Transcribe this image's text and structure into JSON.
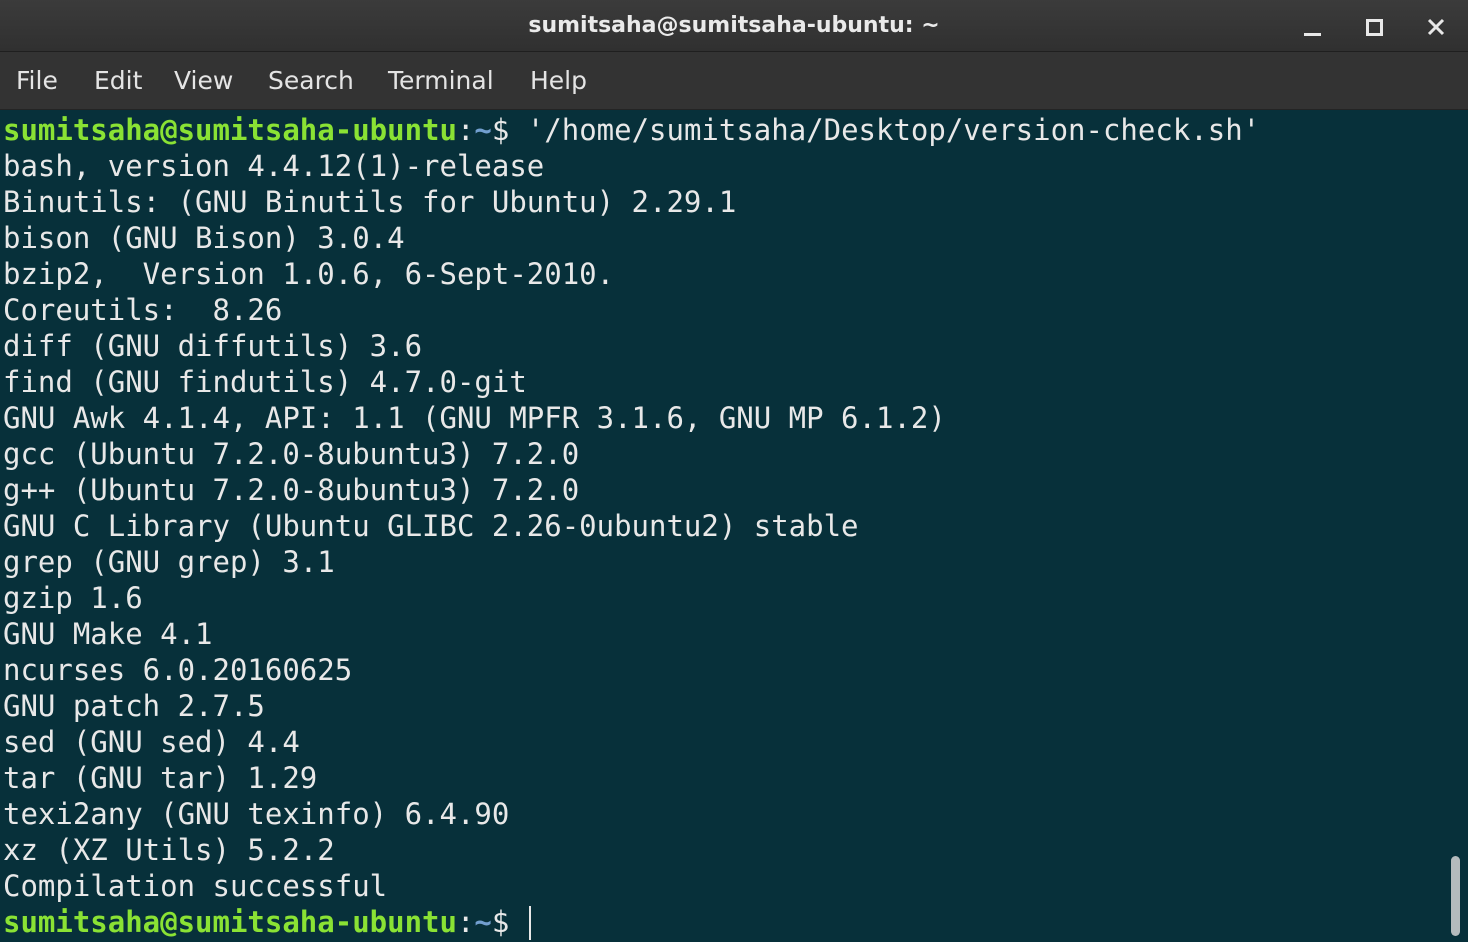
{
  "window": {
    "title": "sumitsaha@sumitsaha-ubuntu: ~",
    "controls": [
      "minimize-icon",
      "maximize-icon",
      "close-icon"
    ]
  },
  "menu": [
    "File",
    "Edit",
    "View",
    "Search",
    "Terminal",
    "Help"
  ],
  "terminal": {
    "prompt": {
      "user": "sumitsaha@sumitsaha-ubuntu",
      "sep": ":",
      "path": "~",
      "sym": "$ "
    },
    "command": "'/home/sumitsaha/Desktop/version-check.sh'",
    "output": [
      "bash, version 4.4.12(1)-release",
      "Binutils: (GNU Binutils for Ubuntu) 2.29.1",
      "bison (GNU Bison) 3.0.4",
      "bzip2,  Version 1.0.6, 6-Sept-2010.",
      "Coreutils:  8.26",
      "diff (GNU diffutils) 3.6",
      "find (GNU findutils) 4.7.0-git",
      "GNU Awk 4.1.4, API: 1.1 (GNU MPFR 3.1.6, GNU MP 6.1.2)",
      "gcc (Ubuntu 7.2.0-8ubuntu3) 7.2.0",
      "g++ (Ubuntu 7.2.0-8ubuntu3) 7.2.0",
      "GNU C Library (Ubuntu GLIBC 2.26-0ubuntu2) stable",
      "grep (GNU grep) 3.1",
      "gzip 1.6",
      "GNU Make 4.1",
      "ncurses 6.0.20160625",
      "GNU patch 2.7.5",
      "sed (GNU sed) 4.4",
      "tar (GNU tar) 1.29",
      "texi2any (GNU texinfo) 6.4.90",
      "xz (XZ Utils) 5.2.2",
      "Compilation successful"
    ]
  },
  "colors": {
    "background": "#07303a",
    "prompt_user": "#8ae234",
    "prompt_path": "#729fcf",
    "text": "#e8e8e8"
  }
}
